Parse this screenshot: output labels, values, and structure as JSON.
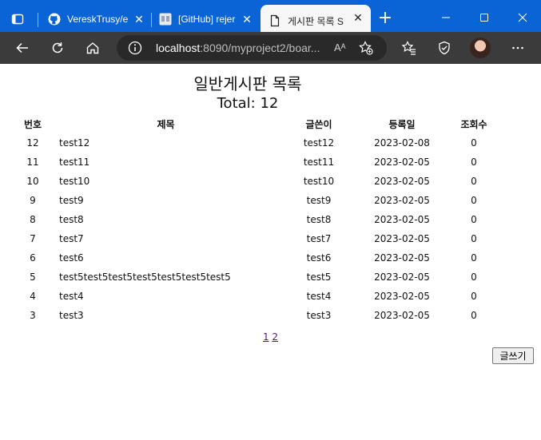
{
  "browser": {
    "tabs": [
      {
        "label": "VereskTrusy/e",
        "icon": "github-icon"
      },
      {
        "label": "[GitHub] rejer",
        "icon": "image-favicon-icon"
      },
      {
        "label": "게시판 목록 S",
        "icon": "document-icon",
        "active": true
      }
    ],
    "address": {
      "host": "localhost",
      "path": ":8090/myproject2/boar...",
      "reader_label": "Aᴬ"
    }
  },
  "board": {
    "title": "일반게시판 목록",
    "total": "Total: 12",
    "headers": {
      "num": "번호",
      "title": "제목",
      "writer": "글쓴이",
      "date": "등록일",
      "views": "조회수"
    },
    "rows": [
      {
        "num": "12",
        "title": "test12",
        "writer": "test12",
        "date": "2023-02-08",
        "views": "0"
      },
      {
        "num": "11",
        "title": "test11",
        "writer": "test11",
        "date": "2023-02-05",
        "views": "0"
      },
      {
        "num": "10",
        "title": "test10",
        "writer": "test10",
        "date": "2023-02-05",
        "views": "0"
      },
      {
        "num": "9",
        "title": "test9",
        "writer": "test9",
        "date": "2023-02-05",
        "views": "0"
      },
      {
        "num": "8",
        "title": "test8",
        "writer": "test8",
        "date": "2023-02-05",
        "views": "0"
      },
      {
        "num": "7",
        "title": "test7",
        "writer": "test7",
        "date": "2023-02-05",
        "views": "0"
      },
      {
        "num": "6",
        "title": "test6",
        "writer": "test6",
        "date": "2023-02-05",
        "views": "0"
      },
      {
        "num": "5",
        "title": "test5test5test5test5test5test5test5",
        "writer": "test5",
        "date": "2023-02-05",
        "views": "0"
      },
      {
        "num": "4",
        "title": "test4",
        "writer": "test4",
        "date": "2023-02-05",
        "views": "0"
      },
      {
        "num": "3",
        "title": "test3",
        "writer": "test3",
        "date": "2023-02-05",
        "views": "0"
      }
    ],
    "pages": [
      "1",
      "2"
    ],
    "write_button": "글쓰기"
  },
  "colors": {
    "titlebar": "#0a64d6",
    "toolbar": "#3b3b3b",
    "address_bar": "#292929",
    "link": "#551a8b"
  }
}
